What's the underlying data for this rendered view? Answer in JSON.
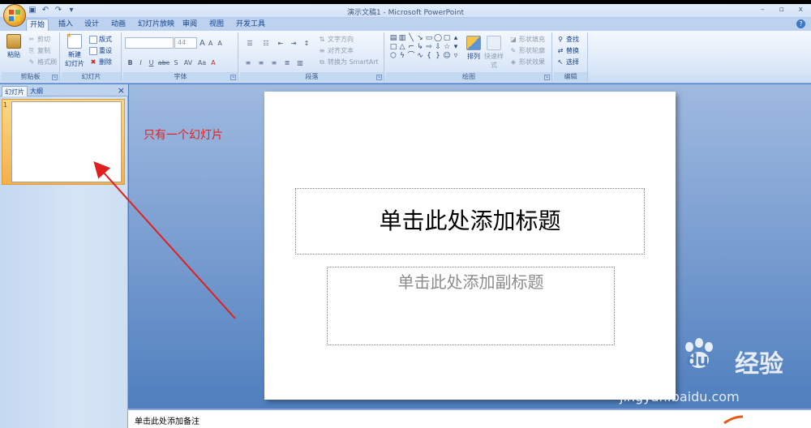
{
  "window": {
    "title": "演示文稿1 - Microsoft PowerPoint",
    "minimize": "–",
    "restore": "▫",
    "close": "x"
  },
  "qat": {
    "save": "💾",
    "undo": "↶",
    "redo": "↷",
    "more": "▾"
  },
  "tabs": [
    "开始",
    "插入",
    "设计",
    "动画",
    "幻灯片放映",
    "审阅",
    "视图",
    "开发工具"
  ],
  "ribbon": {
    "clipboard": {
      "label": "剪贴板",
      "paste": "粘贴",
      "cut": "剪切",
      "copy": "复制",
      "format_painter": "格式刷"
    },
    "slides": {
      "label": "幻灯片",
      "new_slide": "新建",
      "new_slide_2": "幻灯片",
      "layout": "版式",
      "reset": "重设",
      "delete": "删除"
    },
    "font": {
      "label": "字体",
      "font_size": "44",
      "bold": "B",
      "italic": "I",
      "underline": "U",
      "strike": "abc",
      "shadow": "S",
      "spacing": "AV",
      "case": "Aa",
      "grow": "A",
      "shrink": "A",
      "clear": "A"
    },
    "paragraph": {
      "label": "段落",
      "text_direction": "文字方向",
      "align_text": "对齐文本",
      "smartart": "转换为 SmartArt"
    },
    "drawing": {
      "label": "绘图",
      "arrange": "排列",
      "quick_styles": "快速样式",
      "shape_fill": "形状填充",
      "shape_outline": "形状轮廓",
      "shape_effects": "形状效果"
    },
    "editing": {
      "label": "编辑",
      "find": "查找",
      "replace": "替换",
      "select": "选择"
    }
  },
  "left_pane": {
    "tab_slides": "幻灯片",
    "tab_outline": "大纲",
    "close": "×",
    "slide_number": "1"
  },
  "slide": {
    "title_placeholder": "单击此处添加标题",
    "subtitle_placeholder": "单击此处添加副标题"
  },
  "notes_placeholder": "单击此处添加备注",
  "annotation": {
    "text": "只有一个幻灯片",
    "color": "#e02020"
  },
  "watermark": {
    "logo_left": "Bai",
    "logo_right": "经验",
    "logo_du": "du",
    "url": "jingyan.baidu.com"
  },
  "colors": {
    "accent": "#f5b04a",
    "ribbon_text": "#15428b"
  }
}
